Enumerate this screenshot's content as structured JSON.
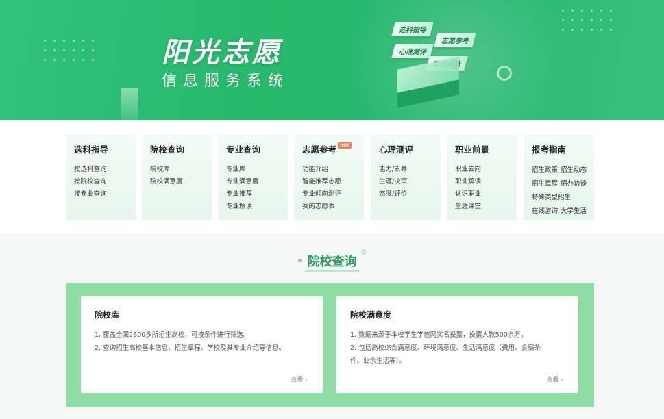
{
  "banner": {
    "title": "阳光志愿",
    "subtitle": "信息服务系统",
    "tags": [
      "选科指导",
      "志愿参考",
      "心理测评",
      "职业前景"
    ]
  },
  "menu": [
    {
      "title": "选科指导",
      "items": [
        "按选科查询",
        "按院校查询",
        "按专业查询"
      ],
      "hot": false
    },
    {
      "title": "院校查询",
      "items": [
        "院校库",
        "院校满意度"
      ],
      "hot": false
    },
    {
      "title": "专业查询",
      "items": [
        "专业库",
        "专业满意度",
        "专业推荐",
        "专业解读"
      ],
      "hot": false
    },
    {
      "title": "志愿参考",
      "items": [
        "功能介绍",
        "智能推荐志愿",
        "专业倾向测评",
        "我的志愿表"
      ],
      "hot": true,
      "hot_label": "HOT"
    },
    {
      "title": "心理测评",
      "items": [
        "能力/素养",
        "生涯/决策",
        "态度/评价"
      ],
      "hot": false
    },
    {
      "title": "职业前景",
      "items": [
        "职业去向",
        "职业解读",
        "认识职业",
        "生涯课堂"
      ],
      "hot": false
    },
    {
      "title": "报考指南",
      "rows": [
        [
          "招生政策",
          "招生动态"
        ],
        [
          "招生章程",
          "招办访谈"
        ],
        [
          "特殊类型招生"
        ],
        [
          "在线咨询",
          "大学生活"
        ]
      ],
      "hot": false
    }
  ],
  "section": {
    "title": "院校查询"
  },
  "cards": [
    {
      "title": "院校库",
      "lines": [
        "1. 覆盖全国2800多所招生高校，可按条件进行筛选。",
        "2. 查询招生高校基本信息、招生章程、学校及其专业介绍等信息。"
      ],
      "more": "查看 ›"
    },
    {
      "title": "院校满意度",
      "lines": [
        "1. 数据来源于本校学生学信网实名投票，投票人数500余万。",
        "2. 包括高校综合满意度、环境满意度、生活满意度（费用、食宿条",
        "件、业余生活等）。"
      ],
      "more": "查看 ›"
    }
  ],
  "colors": {
    "brand": "#2fc27a",
    "panel": "#8fdca6",
    "section_title": "#2a9a5e"
  }
}
